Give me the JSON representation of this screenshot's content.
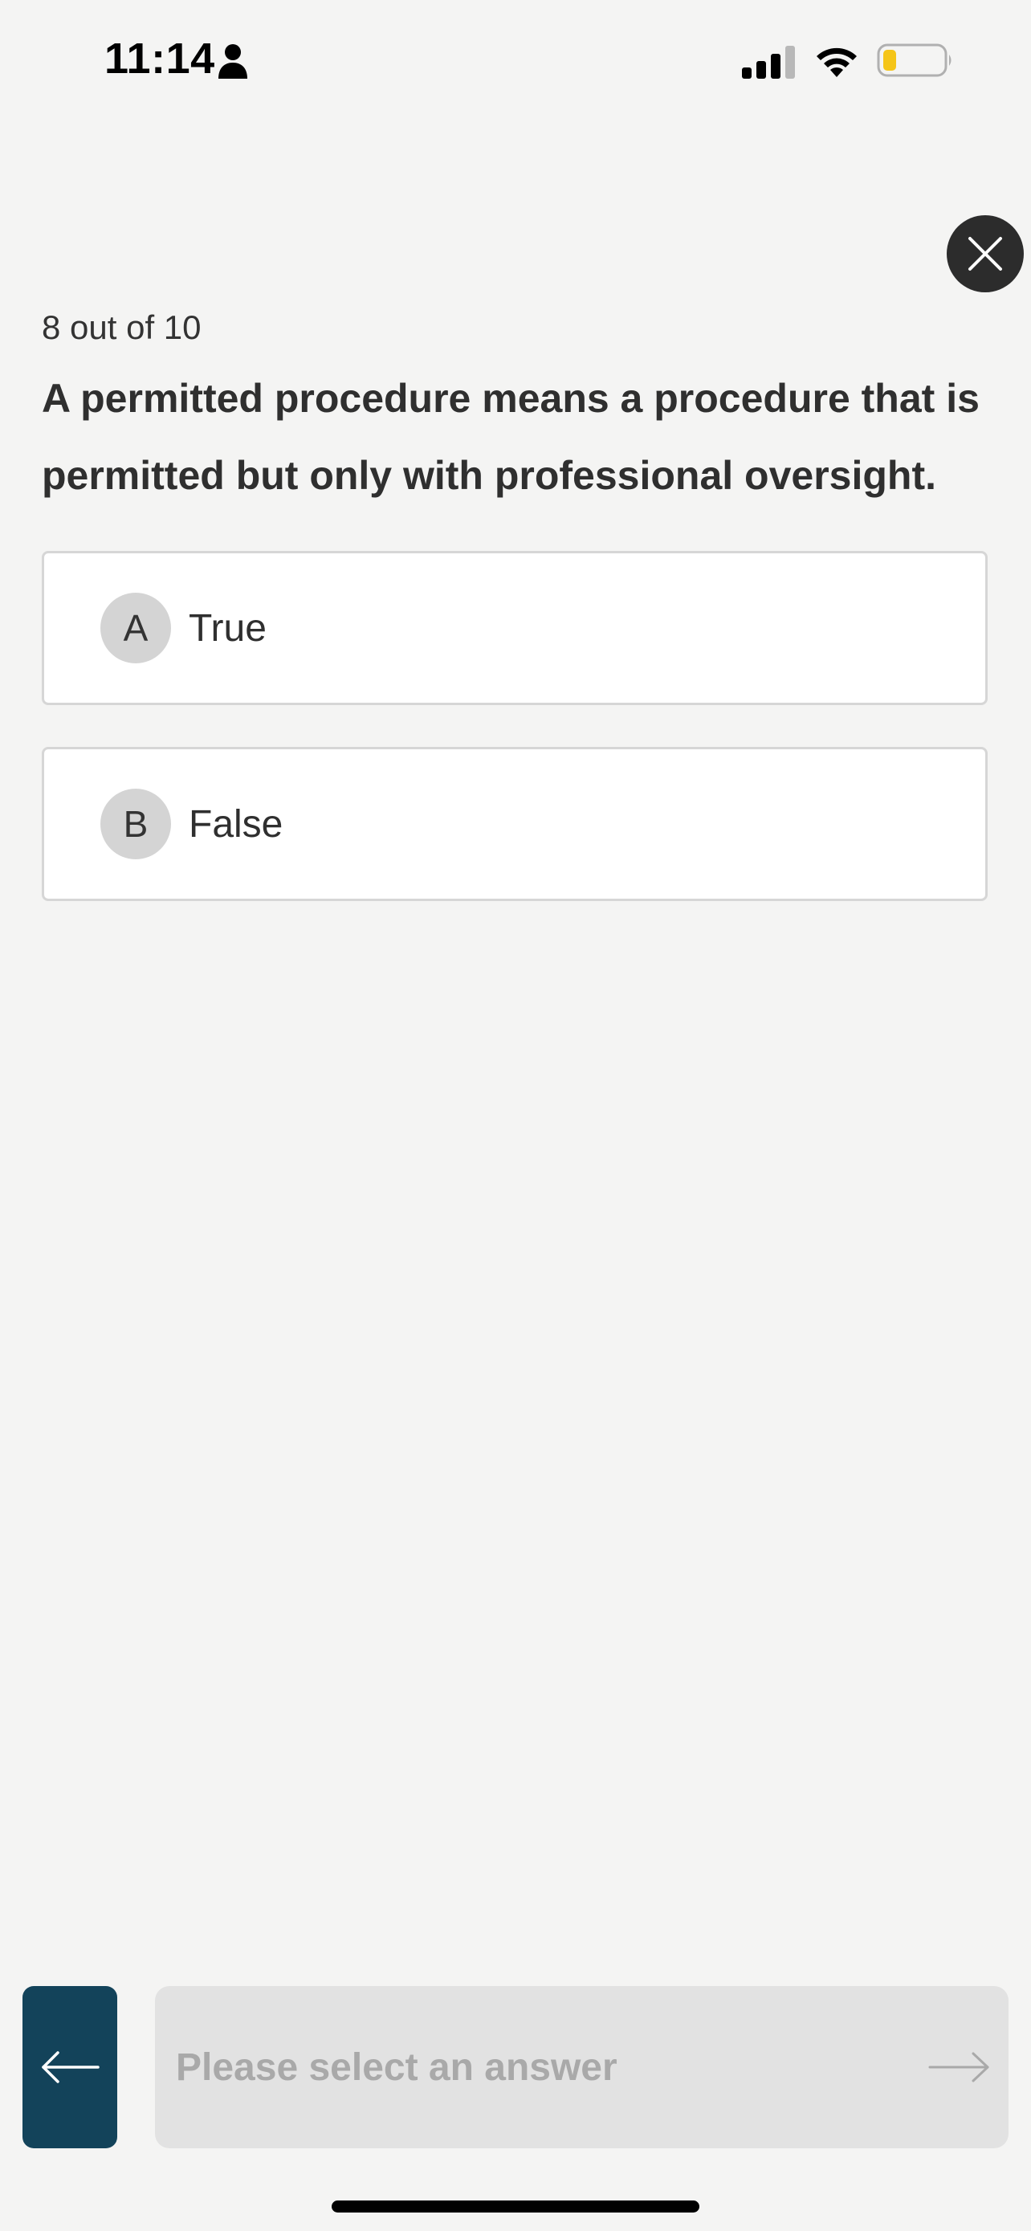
{
  "status_bar": {
    "time": "11:14",
    "icons": [
      "person-icon",
      "signal-icon",
      "wifi-icon",
      "battery-icon"
    ],
    "battery_color": "#f5c518"
  },
  "quiz": {
    "progress": "8 out of 10",
    "question": "A permitted procedure means a procedure that is permitted but only with professional oversight.",
    "answers": [
      {
        "letter": "A",
        "label": "True"
      },
      {
        "letter": "B",
        "label": "False"
      }
    ]
  },
  "navigation": {
    "close_icon": "close-icon",
    "back_icon": "arrow-left-icon",
    "next_placeholder": "Please select an answer",
    "next_icon": "arrow-right-icon"
  },
  "colors": {
    "background": "#f4f4f3",
    "back_button": "#13435a",
    "close_button": "#2c2c2c",
    "disabled_button": "#e2e2e2",
    "disabled_text": "#a9a9a9"
  }
}
